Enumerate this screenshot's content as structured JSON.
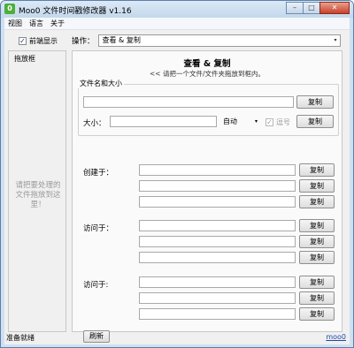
{
  "window": {
    "title": "Moo0 文件时间戳修改器 v1.16",
    "icon_letter": "0",
    "minimize_label": "–",
    "maximize_label": "□",
    "close_label": "✕"
  },
  "menu": [
    "视图",
    "语言",
    "关于"
  ],
  "pin": {
    "checked_mark": "✓",
    "label": "前端显示"
  },
  "operation": {
    "label": "操作：",
    "selected": "查看 & 复制",
    "arrow": "▾"
  },
  "dropzone": {
    "title": "拖放框",
    "hint": "请把要处理的文件拖放到这里！"
  },
  "panel": {
    "title": "查看 & 复制",
    "subtitle": "<< 请把一个文件/文件夹拖放到框内。"
  },
  "name_size": {
    "legend": "文件名和大小",
    "copy_label": "复制",
    "size_label": "大小：",
    "unit_selected": "自动",
    "unit_arrow": "▾",
    "round_mark": "✓",
    "round_label": "逗号"
  },
  "created": {
    "label": "创建于：",
    "copy_labels": [
      "复制",
      "复制",
      "复制"
    ]
  },
  "accessed": {
    "label": "访问于：",
    "copy_labels": [
      "复制",
      "复制",
      "复制"
    ]
  },
  "modified": {
    "label": "访问于:",
    "copy_labels": [
      "复制",
      "复制",
      "复制"
    ]
  },
  "refresh_label": "刷新",
  "status": {
    "text": "准备就绪",
    "link": "moo0"
  }
}
